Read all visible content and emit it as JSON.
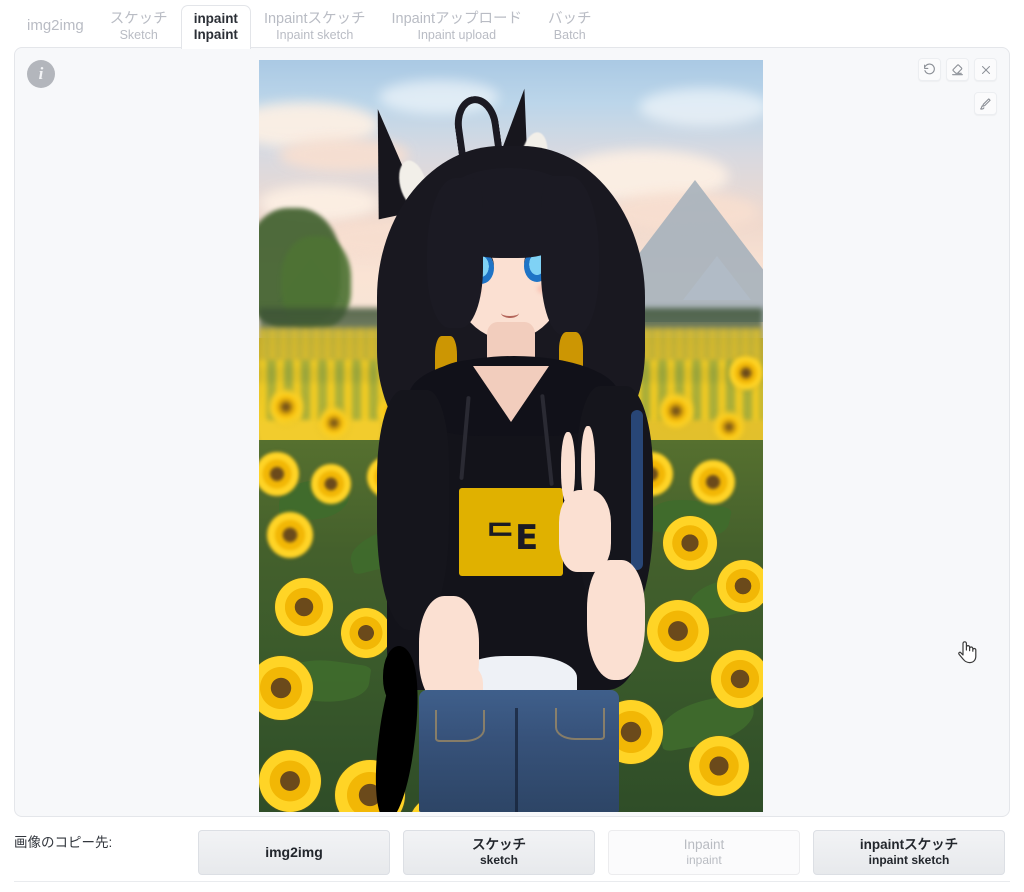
{
  "tabs": [
    {
      "jp": "img2img",
      "en": "",
      "active": false,
      "name": "tab-img2img"
    },
    {
      "jp": "スケッチ",
      "en": "Sketch",
      "active": false,
      "name": "tab-sketch"
    },
    {
      "jp": "inpaint",
      "en": "Inpaint",
      "active": true,
      "name": "tab-inpaint"
    },
    {
      "jp": "Inpaintスケッチ",
      "en": "Inpaint sketch",
      "active": false,
      "name": "tab-inpaint-sketch"
    },
    {
      "jp": "Inpaintアップロード",
      "en": "Inpaint upload",
      "active": false,
      "name": "tab-inpaint-upload"
    },
    {
      "jp": "バッチ",
      "en": "Batch",
      "active": false,
      "name": "tab-batch"
    }
  ],
  "panel": {
    "info_icon": "i",
    "tools": [
      {
        "name": "undo-icon",
        "label": "undo"
      },
      {
        "name": "eraser-icon",
        "label": "eraser"
      },
      {
        "name": "close-icon",
        "label": "close"
      }
    ],
    "tools_row2": [
      {
        "name": "brush-icon",
        "label": "brush"
      }
    ]
  },
  "image": {
    "alt": "anime girl with fox ears in sunflower field, pyramids in background, black inpaint mask stroke over left leg",
    "logo_text": "ᄃE",
    "mask_color": "#000000"
  },
  "bottom": {
    "copy_label": "画像のコピー先:",
    "buttons": [
      {
        "jp": "img2img",
        "en": "",
        "disabled": false,
        "name": "copy-to-img2img-button"
      },
      {
        "jp": "スケッチ",
        "en": "sketch",
        "disabled": false,
        "name": "copy-to-sketch-button"
      },
      {
        "jp": "Inpaint",
        "en": "inpaint",
        "disabled": true,
        "name": "copy-to-inpaint-button"
      },
      {
        "jp": "inpaintスケッチ",
        "en": "inpaint sketch",
        "disabled": false,
        "name": "copy-to-inpaint-sketch-button"
      }
    ]
  },
  "colors": {
    "accent": "#e0b100",
    "panel_bg": "#f7f8fa",
    "border": "#e4e6ea",
    "text": "#2b2f36",
    "muted": "#b9bcc4"
  }
}
